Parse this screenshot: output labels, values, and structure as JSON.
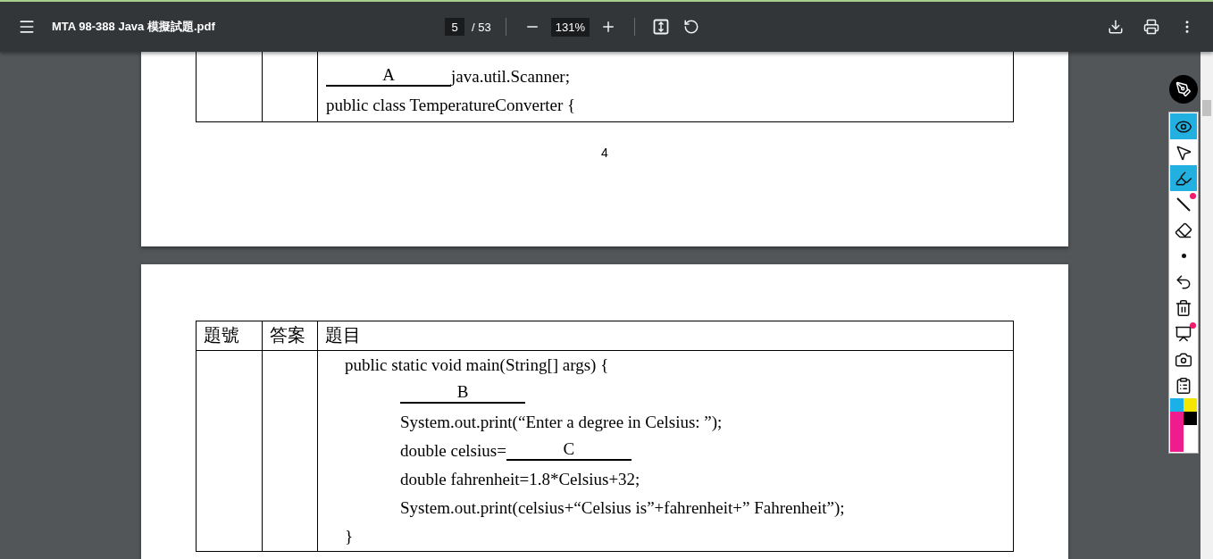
{
  "toolbar": {
    "file_name": "MTA 98-388 Java 模擬試題.pdf",
    "page": "5",
    "page_total": "/ 53",
    "zoom": "131%"
  },
  "pages": [
    {
      "table": {
        "rows": [
          {
            "number": "",
            "answer": "",
            "lines": [
              {
                "kind": "class",
                "segments": [
                  {
                    "kind": "blank",
                    "text": "A"
                  },
                  {
                    "kind": "text",
                    "text": "java.util.Scanner;"
                  }
                ]
              },
              {
                "kind": "class",
                "segments": [
                  {
                    "kind": "text",
                    "text": "public class TemperatureConverter {"
                  }
                ]
              }
            ]
          }
        ]
      },
      "page_number": "4"
    },
    {
      "table": {
        "columns": [
          "題號",
          "答案",
          "題目"
        ],
        "rows": [
          {
            "number": "",
            "answer": "",
            "lines": [
              {
                "kind": "method",
                "segments": [
                  {
                    "kind": "text",
                    "text": "public static void main(String[] args) {"
                  }
                ]
              },
              {
                "kind": "statement",
                "segments": [
                  {
                    "kind": "blank",
                    "text": "B"
                  }
                ]
              },
              {
                "kind": "statement",
                "segments": [
                  {
                    "kind": "text",
                    "text": "System.out.print(“Enter a degree in Celsius: ”);"
                  }
                ]
              },
              {
                "kind": "statement",
                "segments": [
                  {
                    "kind": "text",
                    "text": "double celsius="
                  },
                  {
                    "kind": "blank",
                    "text": "C"
                  }
                ]
              },
              {
                "kind": "statement",
                "segments": [
                  {
                    "kind": "text",
                    "text": "double fahrenheit=1.8*Celsius+32;"
                  }
                ]
              },
              {
                "kind": "statement",
                "segments": [
                  {
                    "kind": "text",
                    "text": "System.out.print(celsius+“Celsius is”+fahrenheit+” Fahrenheit”);"
                  }
                ]
              },
              {
                "kind": "method",
                "segments": [
                  {
                    "kind": "text",
                    "text": "}"
                  }
                ]
              }
            ]
          }
        ]
      }
    }
  ],
  "annotation_tools": [
    {
      "kind": "eye",
      "selected": true,
      "dot": false
    },
    {
      "kind": "pointer",
      "selected": false,
      "dot": false
    },
    {
      "kind": "highlighter",
      "selected": true,
      "dot": false
    },
    {
      "kind": "line",
      "selected": false,
      "dot": true
    },
    {
      "kind": "eraser",
      "selected": false,
      "dot": false
    },
    {
      "kind": "point",
      "selected": false,
      "dot": false
    },
    {
      "kind": "undo",
      "selected": false,
      "dot": false
    },
    {
      "kind": "trash",
      "selected": false,
      "dot": false
    },
    {
      "kind": "easel",
      "selected": false,
      "dot": true
    },
    {
      "kind": "camera",
      "selected": false,
      "dot": false
    },
    {
      "kind": "clipboard",
      "selected": false,
      "dot": false
    }
  ],
  "swatches": [
    {
      "color": "#1ab0e8"
    },
    {
      "color": "#f5e600"
    },
    {
      "color": "#ee1c8c"
    },
    {
      "color": "#000000"
    }
  ]
}
